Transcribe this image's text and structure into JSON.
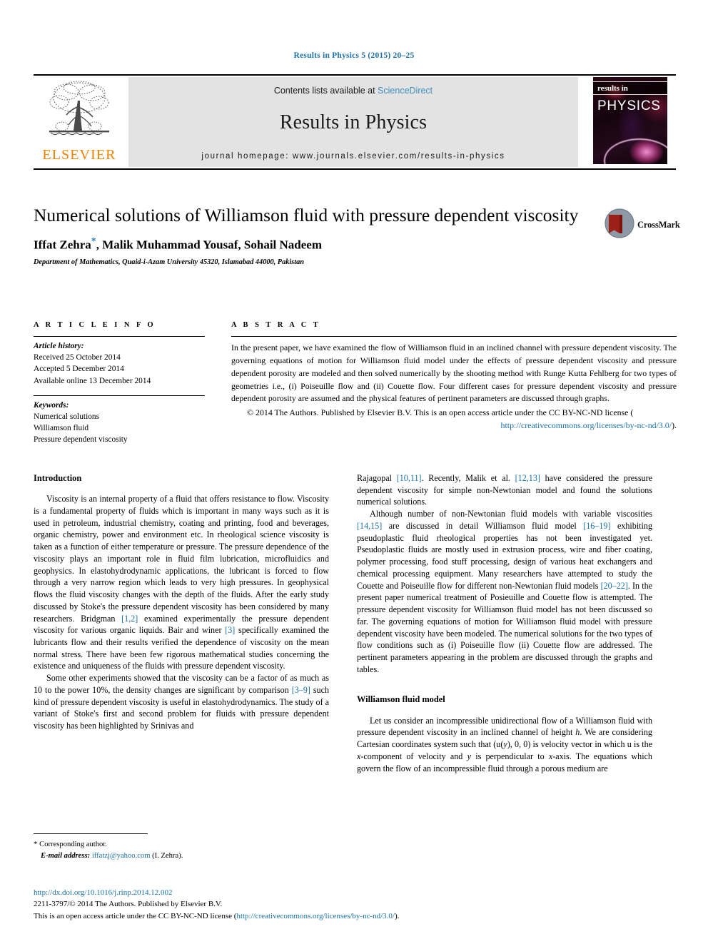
{
  "running_head": "Results in Physics 5 (2015) 20–25",
  "masthead": {
    "publisher_wordmark": "ELSEVIER",
    "contents_prefix": "Contents lists available at",
    "contents_link": "ScienceDirect",
    "journal_name": "Results in Physics",
    "homepage": "journal homepage: www.journals.elsevier.com/results-in-physics",
    "cover_band_text": "results in",
    "cover_title": "PHYSICS"
  },
  "article": {
    "title": "Numerical solutions of Williamson fluid with pressure dependent viscosity",
    "authors": "Iffat Zehra",
    "authors_rest": ", Malik Muhammad Yousaf, Sohail Nadeem",
    "corresponding_marker": "*",
    "affiliation": "Department of Mathematics, Quaid-i-Azam University 45320, Islamabad 44000, Pakistan",
    "crossmark_label": "CrossMark"
  },
  "article_info": {
    "heading": "A R T I C L E    I N F O",
    "history_label": "Article history:",
    "history": [
      "Received 25 October 2014",
      "Accepted 5 December 2014",
      "Available online 13 December 2014"
    ],
    "keywords_label": "Keywords:",
    "keywords": [
      "Numerical solutions",
      "Williamson fluid",
      "Pressure dependent viscosity"
    ]
  },
  "abstract": {
    "heading": "A B S T R A C T",
    "text": "In the present paper, we have examined the flow of Williamson fluid in an inclined channel with pressure dependent viscosity. The governing equations of motion for Williamson fluid model under the effects of pressure dependent viscosity and pressure dependent porosity are modeled and then solved numerically by the shooting method with Runge Kutta Fehlberg for two types of geometries i.e., (i) Poiseuille flow and (ii) Couette flow. Four different cases for pressure dependent viscosity and pressure dependent porosity are assumed and the physical features of pertinent parameters are discussed through graphs.",
    "copyright": "© 2014 The Authors. Published by Elsevier B.V. This is an open access article under the CC BY-NC-ND license (",
    "license_link": "http://creativecommons.org/licenses/by-nc-nd/3.0/",
    "copyright_tail": ")."
  },
  "body": {
    "introduction_heading": "Introduction",
    "left_p1_a": "Viscosity is an internal property of a fluid that offers resistance to flow. Viscosity is a fundamental property of fluids which is important in many ways such as it is used in petroleum, industrial chemistry, coating and printing, food and beverages, organic chemistry, power and environment etc. In rheological science viscosity is taken as a function of either temperature or pressure. The pressure dependence of the viscosity plays an important role in fluid film lubrication, microfluidics and geophysics. In elastohydrodynamic applications, the lubricant is forced to flow through a very narrow region which leads to very high pressures. In geophysical flows the fluid viscosity changes with the depth of the fluids. After the early study discussed by Stoke's the pressure dependent viscosity has been considered by many researchers. Bridgman ",
    "cite_1_2": "[1,2]",
    "left_p1_b": " examined experimentally the pressure dependent viscosity for various organic liquids. Bair and winer ",
    "cite_3": "[3]",
    "left_p1_c": " specifically examined the lubricants flow and their results verified the dependence of viscosity on the mean normal stress. There have been few rigorous mathematical studies concerning the existence and uniqueness of the fluids with pressure dependent viscosity.",
    "left_p2_a": "Some other experiments showed that the viscosity can be a factor of as much as 10 to the power 10%, the density changes are significant by comparison ",
    "cite_3_9": "[3–9]",
    "left_p2_b": " such kind of pressure dependent viscosity is useful in elastohydrodynamics. The study of a variant of Stoke's first and second problem for fluids with pressure dependent viscosity has been highlighted by Srinivas and",
    "right_p1_a": "Rajagopal ",
    "cite_10_11": "[10,11]",
    "right_p1_b": ". Recently, Malik et al. ",
    "cite_12_13": "[12,13]",
    "right_p1_c": " have considered the pressure dependent viscosity for simple non-Newtonian model and found the solutions numerical solutions.",
    "right_p2_a": "Although number of non-Newtonian fluid models with variable viscosities ",
    "cite_14_15": "[14,15]",
    "right_p2_b": " are discussed in detail Williamson fluid model ",
    "cite_16_19": "[16–19]",
    "right_p2_c": " exhibiting pseudoplastic fluid rheological properties has not been investigated yet. Pseudoplastic fluids are mostly used in extrusion process, wire and fiber coating, polymer processing, food stuff processing, design of various heat exchangers and chemical processing equipment. Many researchers have attempted to study the Couette and Poiseuille flow for different non-Newtonian fluid models ",
    "cite_20_22": "[20–22]",
    "right_p2_d": ". In the present paper numerical treatment of Posieuille and Couette flow is attempted. The pressure dependent viscosity for Williamson fluid model has not been discussed so far. The governing equations of motion for Williamson fluid model with pressure dependent viscosity have been modeled. The numerical solutions for the two types of flow conditions such as (i) Poiseuille flow (ii) Couette flow are addressed. The pertinent parameters appearing in the problem are discussed through the graphs and tables.",
    "model_heading": "Williamson fluid model",
    "right_p3_a": "Let us consider an incompressible unidirectional flow of a Williamson fluid with pressure dependent viscosity in an inclined channel of height ",
    "var_h": "h",
    "right_p3_b": ". We are considering Cartesian coordinates system such that (u(",
    "var_y1": "y",
    "right_p3_c": "), 0, 0) is velocity vector in which u is the ",
    "var_x1": "x",
    "right_p3_d": "-component of velocity and ",
    "var_y2": "y",
    "right_p3_e": " is perpendicular to ",
    "var_x2": "x",
    "right_p3_f": "-axis. The equations which govern the flow of an incompressible fluid through a porous medium are"
  },
  "footnote": {
    "corresponding": "Corresponding author.",
    "email_label": "E-mail address:",
    "email": "iffatzj@yahoo.com",
    "email_owner": "(I. Zehra)."
  },
  "footer": {
    "doi": "http://dx.doi.org/10.1016/j.rinp.2014.12.002",
    "issn_line": "2211-3797/© 2014 The Authors. Published by Elsevier B.V.",
    "license_prefix": "This is an open access article under the CC BY-NC-ND license (",
    "license_link": "http://creativecommons.org/licenses/by-nc-nd/3.0/",
    "license_tail": ")."
  },
  "colors": {
    "link_blue": "#1a72a8",
    "sciencedirect_blue": "#3d8fbe",
    "elsevier_orange": "#ef8200",
    "band_gray": "#e3e3e3"
  }
}
